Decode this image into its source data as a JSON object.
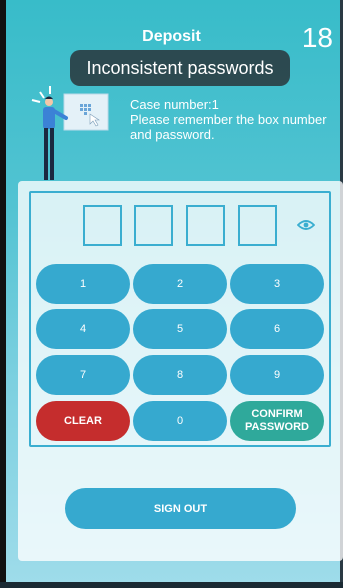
{
  "header": {
    "title": "Deposit",
    "countdown": "18"
  },
  "toast": {
    "message": "Inconsistent passwords"
  },
  "case": {
    "number_line": "Case number:1",
    "instruction_line1": "Please remember the box number",
    "instruction_line2": "and password."
  },
  "keypad": {
    "keys": [
      "1",
      "2",
      "3",
      "4",
      "5",
      "6",
      "7",
      "8",
      "9"
    ],
    "clear_label": "CLEAR",
    "zero_label": "0",
    "confirm_label_line1": "CONFIRM",
    "confirm_label_line2": "PASSWORD"
  },
  "footer": {
    "signout_label": "SIGN OUT"
  },
  "colors": {
    "accent": "#36a9cf",
    "clear": "#c52d2d",
    "confirm": "#2fa99b",
    "toast_bg": "#283034"
  }
}
